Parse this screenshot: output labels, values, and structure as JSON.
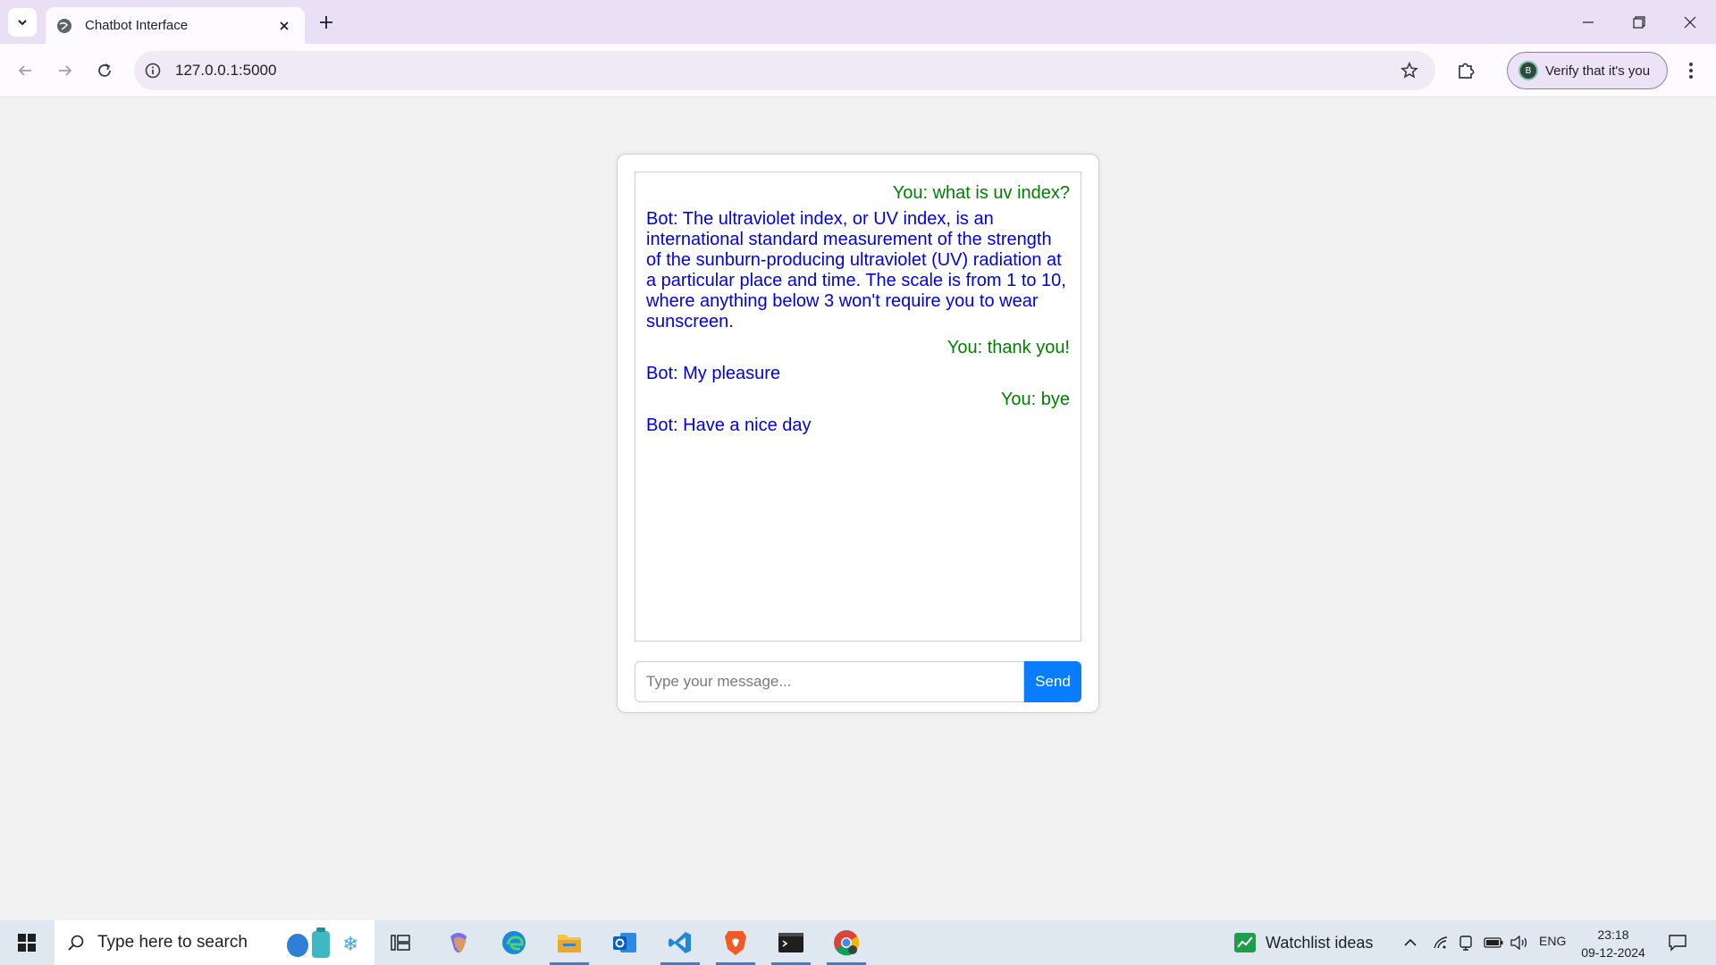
{
  "browser": {
    "tab_title": "Chatbot Interface",
    "url": "127.0.0.1:5000",
    "profile_label": "Verify that it's you",
    "profile_initial": "B"
  },
  "chat": {
    "messages": [
      {
        "role": "user",
        "text": "You: what is uv index?"
      },
      {
        "role": "bot",
        "text": "Bot: The ultraviolet index, or UV index, is an international standard measurement of the strength of the sunburn-producing ultraviolet (UV) radiation at a particular place and time. The scale is from 1 to 10, where anything below 3 won't require you to wear sunscreen."
      },
      {
        "role": "user",
        "text": "You: thank you!"
      },
      {
        "role": "bot",
        "text": "Bot: My pleasure"
      },
      {
        "role": "user",
        "text": "You: bye"
      },
      {
        "role": "bot",
        "text": "Bot: Have a nice day"
      }
    ],
    "input_placeholder": "Type your message...",
    "input_value": "",
    "send_label": "Send",
    "colors": {
      "user": "#008000",
      "bot": "#0000e6",
      "send_button": "#0a7cff"
    }
  },
  "taskbar": {
    "search_placeholder": "Type here to search",
    "watchlist_label": "Watchlist ideas",
    "language": "ENG",
    "time": "23:18",
    "date": "09-12-2024",
    "apps": [
      "task-view-icon",
      "copilot-icon",
      "edge-icon",
      "file-explorer-icon",
      "outlook-icon",
      "vscode-icon",
      "brave-icon",
      "terminal-icon",
      "chrome-icon"
    ]
  }
}
